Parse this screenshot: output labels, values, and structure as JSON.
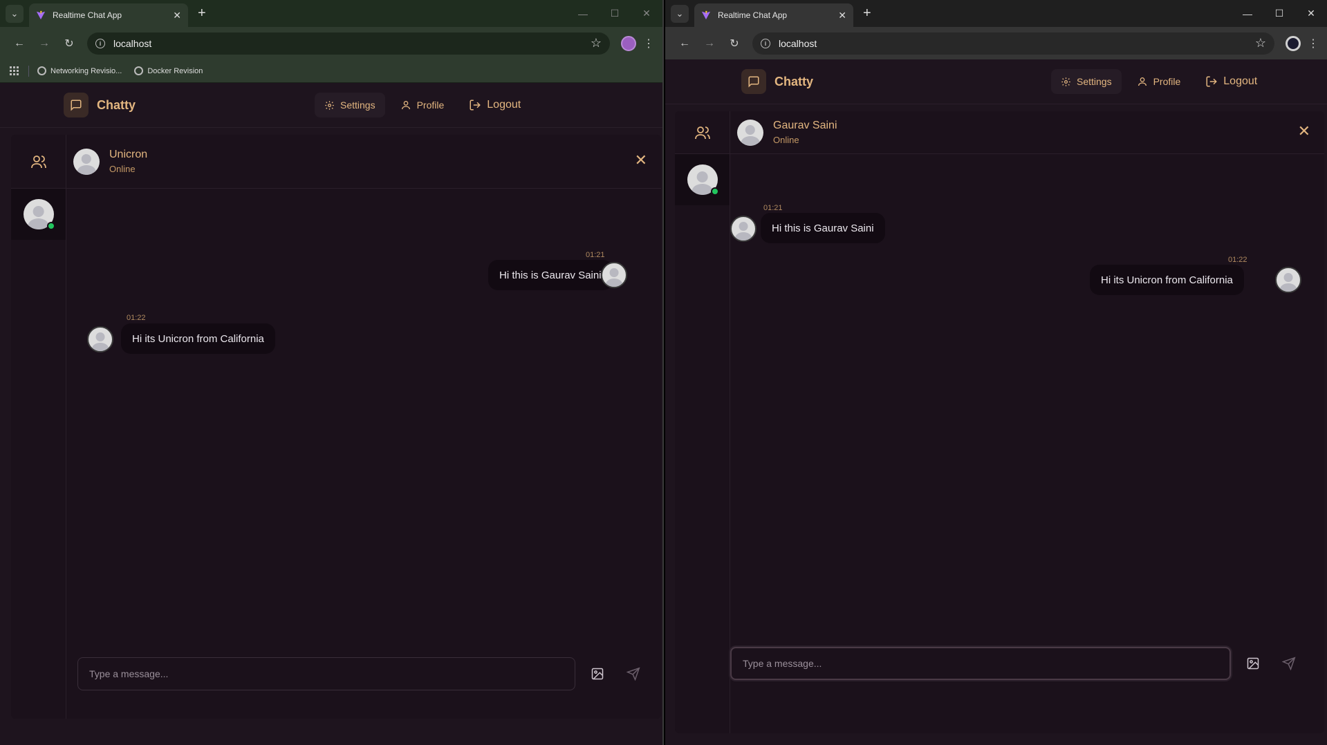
{
  "left": {
    "tab": {
      "title": "Realtime Chat App"
    },
    "address": "localhost",
    "bookmarks": [
      "Networking Revisio...",
      "Docker Revision"
    ],
    "app": {
      "brand": "Chatty",
      "nav": {
        "settings": "Settings",
        "profile": "Profile",
        "logout": "Logout"
      },
      "chat_header": {
        "name": "Unicron",
        "status": "Online"
      },
      "messages": [
        {
          "time": "01:21",
          "text": "Hi this is Gaurav Saini",
          "side": "right"
        },
        {
          "time": "01:22",
          "text": "Hi its Unicron from California",
          "side": "left"
        }
      ],
      "composer": {
        "placeholder": "Type a message..."
      }
    }
  },
  "right": {
    "tab": {
      "title": "Realtime Chat App"
    },
    "address": "localhost",
    "app": {
      "brand": "Chatty",
      "nav": {
        "settings": "Settings",
        "profile": "Profile",
        "logout": "Logout"
      },
      "chat_header": {
        "name": "Gaurav Saini",
        "status": "Online"
      },
      "messages": [
        {
          "time": "01:21",
          "text": "Hi this is Gaurav Saini",
          "side": "left"
        },
        {
          "time": "01:22",
          "text": "Hi its Unicron from California",
          "side": "right"
        }
      ],
      "composer": {
        "placeholder": "Type a message..."
      }
    }
  },
  "colors": {
    "accent": "#e3b680",
    "background": "#1e141e",
    "bubble": "#120a12",
    "online": "#22c55e"
  },
  "icons": [
    "chat-bubble-icon",
    "gear-icon",
    "user-icon",
    "logout-icon",
    "users-icon",
    "close-icon",
    "image-icon",
    "send-icon",
    "star-icon",
    "info-icon"
  ]
}
